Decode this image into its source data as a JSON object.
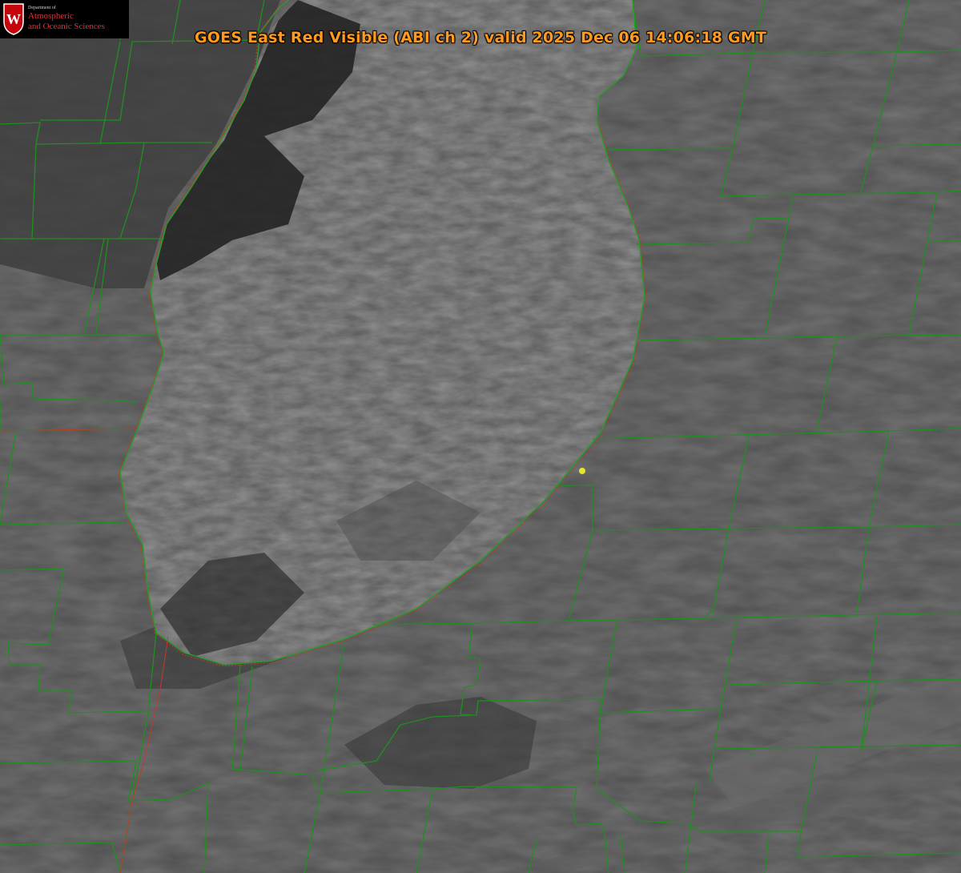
{
  "title": "GOES East Red Visible (ABI ch 2) valid 2025 Dec 06 14:06:18 GMT",
  "logo": {
    "department_text": "Department of",
    "line1": "Atmospheric",
    "line2": "and Oceanic Sciences",
    "shield_letter": "W",
    "shield_color": "#c5050c"
  },
  "colors": {
    "county_borders": "#1f8f1f",
    "state_border": "#c23a2a",
    "title_text": "#ff9a1f",
    "station_marker": "#e6e62a"
  },
  "layers": [
    "satellite-visible-imagery",
    "county-borders",
    "state-borders",
    "lake-shoreline",
    "station-marker"
  ]
}
